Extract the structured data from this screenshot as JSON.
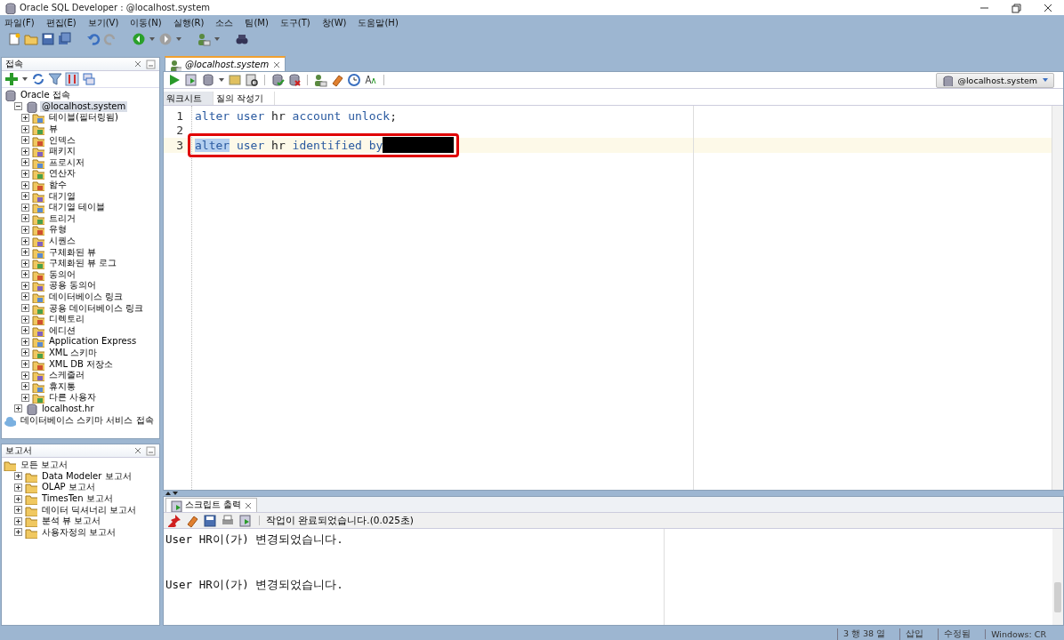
{
  "window": {
    "title": "Oracle SQL Developer : @localhost.system"
  },
  "menu": [
    "파일(F)",
    "편집(E)",
    "보기(V)",
    "이동(N)",
    "실행(R)",
    "소스",
    "팀(M)",
    "도구(T)",
    "창(W)",
    "도움말(H)"
  ],
  "connections_panel": {
    "title": "접속",
    "tree": [
      {
        "label": "Oracle 접속",
        "selected": false,
        "children": [
          {
            "label": "@localhost.system",
            "expanded": true,
            "selected": true,
            "children": [
              {
                "label": "테이블(필터링됨)",
                "expanded": false,
                "selected": false
              },
              {
                "label": "뷰",
                "expanded": false,
                "selected": false
              },
              {
                "label": "인덱스",
                "expanded": false,
                "selected": false
              },
              {
                "label": "패키지",
                "expanded": false,
                "selected": false
              },
              {
                "label": "프로시저",
                "expanded": false,
                "selected": false
              },
              {
                "label": "연산자",
                "expanded": false,
                "selected": false
              },
              {
                "label": "함수",
                "expanded": false,
                "selected": false
              },
              {
                "label": "대기열",
                "expanded": false,
                "selected": false
              },
              {
                "label": "대기열 테이블",
                "expanded": false,
                "selected": false
              },
              {
                "label": "트리거",
                "expanded": false,
                "selected": false
              },
              {
                "label": "유형",
                "expanded": false,
                "selected": false
              },
              {
                "label": "시퀀스",
                "expanded": false,
                "selected": false
              },
              {
                "label": "구체화된 뷰",
                "expanded": false,
                "selected": false
              },
              {
                "label": "구체화된 뷰 로그",
                "expanded": false,
                "selected": false
              },
              {
                "label": "동의어",
                "expanded": false,
                "selected": false
              },
              {
                "label": "공용 동의어",
                "expanded": false,
                "selected": false
              },
              {
                "label": "데이터베이스 링크",
                "expanded": false,
                "selected": false
              },
              {
                "label": "공용 데이터베이스 링크",
                "expanded": false,
                "selected": false
              },
              {
                "label": "디렉토리",
                "expanded": false,
                "selected": false
              },
              {
                "label": "에디션",
                "expanded": false,
                "selected": false
              },
              {
                "label": "Application Express",
                "expanded": false,
                "selected": false
              },
              {
                "label": "XML 스키마",
                "expanded": false,
                "selected": false
              },
              {
                "label": "XML DB 저장소",
                "expanded": false,
                "selected": false
              },
              {
                "label": "스케줄러",
                "expanded": false,
                "selected": false
              },
              {
                "label": "휴지통",
                "expanded": false,
                "selected": false
              },
              {
                "label": "다른 사용자",
                "expanded": false,
                "selected": false
              }
            ]
          },
          {
            "label": "localhost.hr",
            "expanded": false,
            "selected": false
          }
        ]
      },
      {
        "label": "데이터베이스 스키마 서비스 접속",
        "selected": false
      }
    ]
  },
  "reports_panel": {
    "title": "보고서",
    "tree": [
      {
        "label": "모든 보고서",
        "selected": false,
        "children": [
          {
            "label": "Data Modeler 보고서",
            "expanded": false,
            "selected": false
          },
          {
            "label": "OLAP 보고서",
            "expanded": false,
            "selected": false
          },
          {
            "label": "TimesTen 보고서",
            "expanded": false,
            "selected": false
          },
          {
            "label": "데이터 딕셔너리 보고서",
            "expanded": false,
            "selected": false
          },
          {
            "label": "분석 뷰 보고서",
            "expanded": false,
            "selected": false
          },
          {
            "label": "사용자정의 보고서",
            "expanded": false,
            "selected": false
          }
        ]
      }
    ]
  },
  "editor": {
    "tab": "@localhost.system",
    "connection": "@localhost.system",
    "subtabs": [
      {
        "label": "워크시트",
        "selected": true
      },
      {
        "label": "질의 작성기",
        "selected": false
      }
    ],
    "lines": [
      {
        "number": "1",
        "current": false,
        "boxed": false,
        "redacted": false,
        "tokens": [
          {
            "text": "alter",
            "kind": "keyword",
            "selected": false
          },
          {
            "text": " user",
            "kind": "keyword",
            "selected": false
          },
          {
            "text": " hr",
            "kind": "plain",
            "selected": false
          },
          {
            "text": " account",
            "kind": "keyword",
            "selected": false
          },
          {
            "text": " unlock",
            "kind": "keyword",
            "selected": false
          },
          {
            "text": ";",
            "kind": "plain",
            "selected": false
          }
        ]
      },
      {
        "number": "2",
        "current": false,
        "boxed": false,
        "redacted": false
      },
      {
        "number": "3",
        "current": true,
        "boxed": true,
        "redacted": true,
        "tokens": [
          {
            "text": "alter",
            "kind": "keyword",
            "selected": true
          },
          {
            "text": " user",
            "kind": "keyword",
            "selected": false
          },
          {
            "text": " hr",
            "kind": "plain",
            "selected": false
          },
          {
            "text": " identified",
            "kind": "keyword",
            "selected": false
          },
          {
            "text": " by",
            "kind": "keyword",
            "selected": false
          }
        ]
      }
    ]
  },
  "output": {
    "tab": "스크립트 출력",
    "status": "작업이 완료되었습니다.(0.025초)",
    "lines": [
      "User HR이(가) 변경되었습니다.",
      "User HR이(가) 변경되었습니다."
    ]
  },
  "status_bar": [
    "3 행 38 열",
    "삽입",
    "수정됨",
    "Windows: CR"
  ]
}
